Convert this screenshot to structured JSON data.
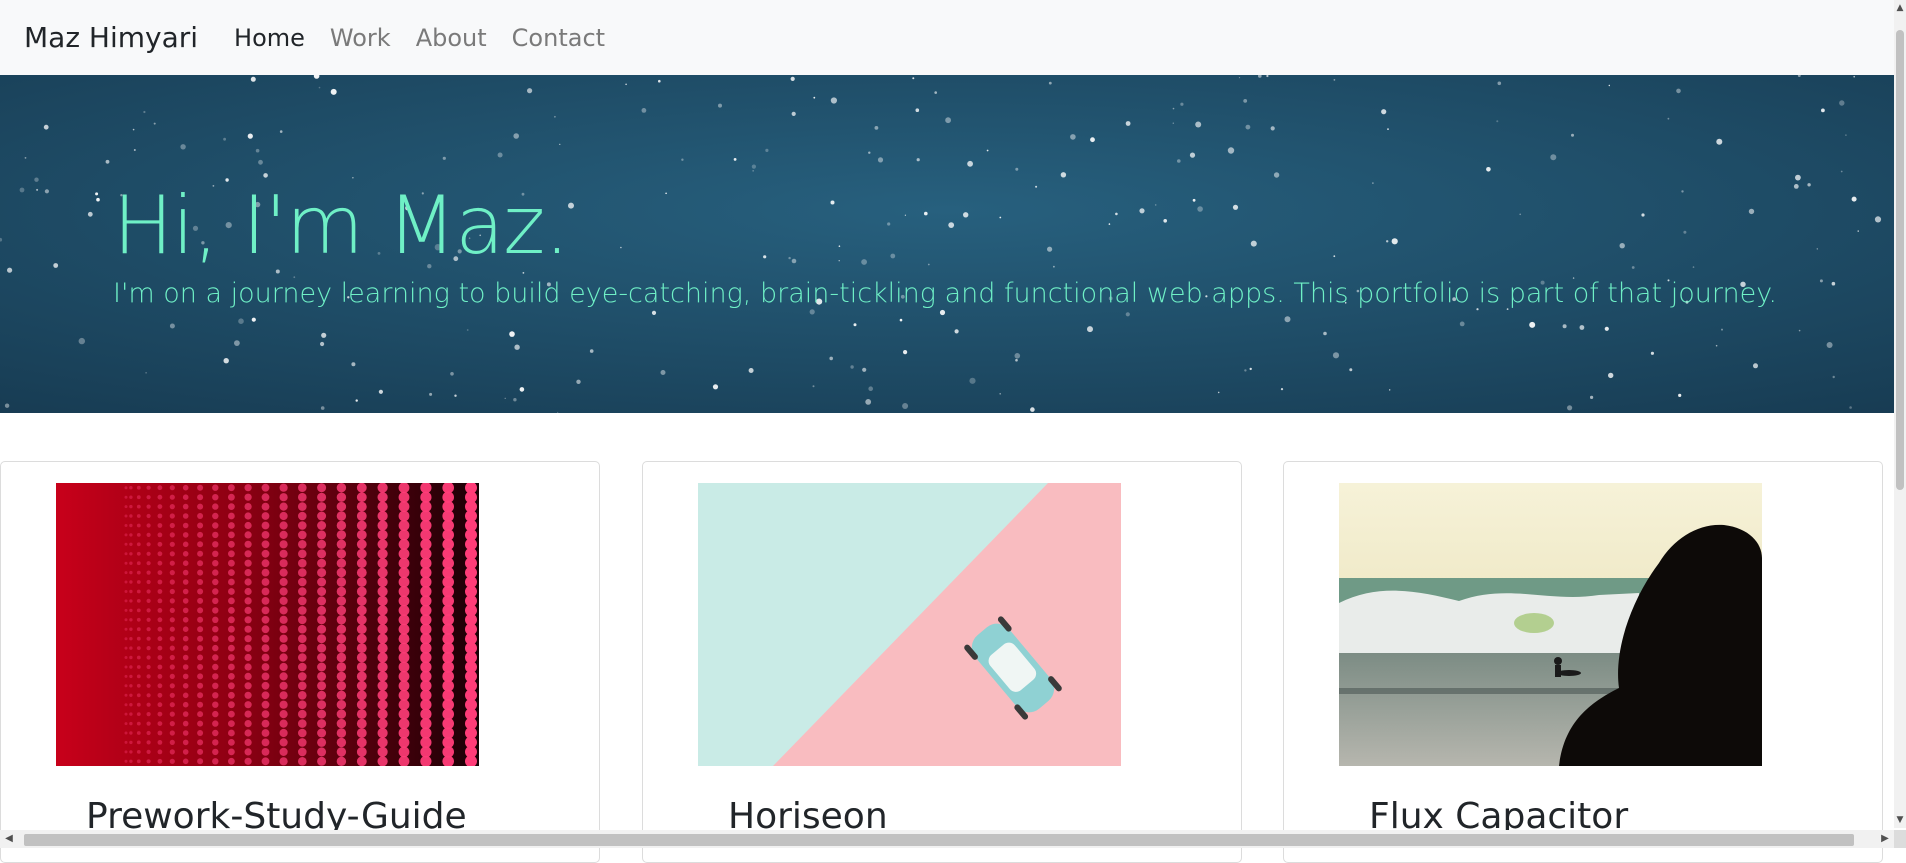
{
  "navbar": {
    "brand": "Maz Himyari",
    "links": [
      {
        "label": "Home",
        "active": true
      },
      {
        "label": "Work",
        "active": false
      },
      {
        "label": "About",
        "active": false
      },
      {
        "label": "Contact",
        "active": false
      }
    ]
  },
  "hero": {
    "title": "Hi, I'm Maz.",
    "subtitle": "I'm on a journey learning to build eye-catching, brain-tickling and functional web apps. This portfolio is part of that journey."
  },
  "cards": [
    {
      "title": "Prework-Study-Guide",
      "image": "red-led-wall-image"
    },
    {
      "title": "Horiseon",
      "image": "toy-car-pastel-image"
    },
    {
      "title": "Flux Capacitor",
      "image": "surfer-sunset-image"
    }
  ],
  "colors": {
    "hero_text": "#6ff0c6",
    "hero_bg": "#1f4a64",
    "navbar_bg": "#f8f9fa"
  }
}
